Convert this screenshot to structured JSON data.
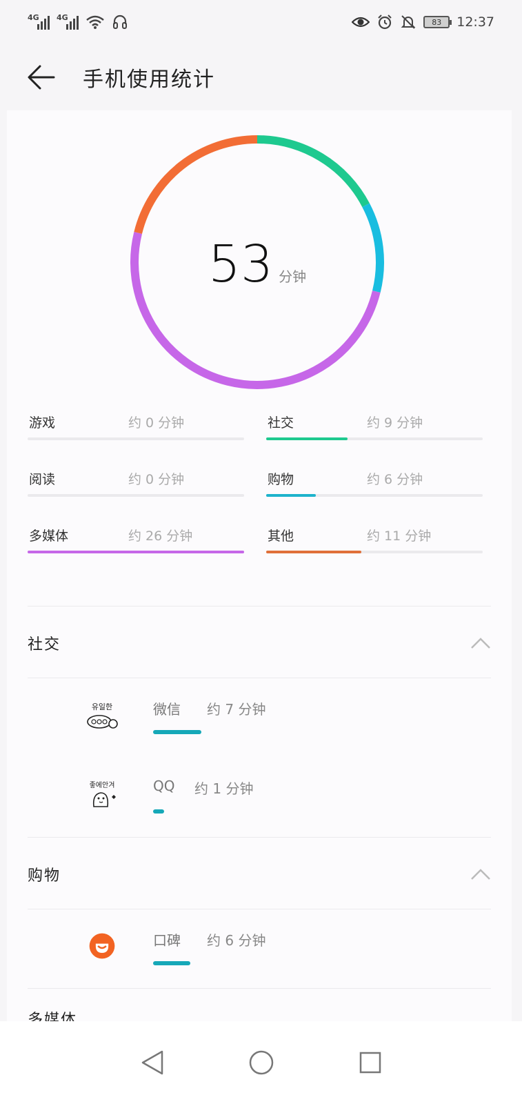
{
  "status_bar": {
    "sim1": "4G",
    "sim2": "4G",
    "battery": "83",
    "time": "12:37",
    "icons": [
      "signal-icon",
      "wifi-icon",
      "headset-icon",
      "eye-icon",
      "alarm-icon",
      "mute-icon",
      "battery-icon"
    ]
  },
  "app_bar": {
    "title": "手机使用统计"
  },
  "summary": {
    "total": "53",
    "unit": "分钟",
    "segments": [
      {
        "name": "社交",
        "minutes": 9,
        "color": "#1ec98f"
      },
      {
        "name": "购物",
        "minutes": 6,
        "color": "#19bde0"
      },
      {
        "name": "多媒体",
        "minutes": 26,
        "color": "#c667e8"
      },
      {
        "name": "其他",
        "minutes": 11,
        "color": "#f26d35"
      }
    ]
  },
  "categories": [
    {
      "name": "游戏",
      "time": "约 0 分钟",
      "fraction": 0.0,
      "color": "#cccccc"
    },
    {
      "name": "社交",
      "time": "约 9 分钟",
      "fraction": 0.375,
      "color": "#1ec98f"
    },
    {
      "name": "阅读",
      "time": "约 0 分钟",
      "fraction": 0.0,
      "color": "#cccccc"
    },
    {
      "name": "购物",
      "time": "约 6 分钟",
      "fraction": 0.23,
      "color": "#1eb3cc"
    },
    {
      "name": "多媒体",
      "time": "约 26 分钟",
      "fraction": 1.0,
      "color": "#c667e8"
    },
    {
      "name": "其他",
      "time": "约 11 分钟",
      "fraction": 0.44,
      "color": "#e0703a"
    }
  ],
  "sections": [
    {
      "title": "社交",
      "apps": [
        {
          "name": "微信",
          "time": "约 7 分钟",
          "fraction": 0.7,
          "icon": "wechat-sticker-icon"
        },
        {
          "name": "QQ",
          "time": "约 1 分钟",
          "fraction": 0.16,
          "icon": "qq-sticker-icon"
        }
      ]
    },
    {
      "title": "购物",
      "apps": [
        {
          "name": "口碑",
          "time": "约 6 分钟",
          "fraction": 0.54,
          "icon": "koubei-icon"
        }
      ]
    }
  ],
  "next_section_partial": "多媒体"
}
